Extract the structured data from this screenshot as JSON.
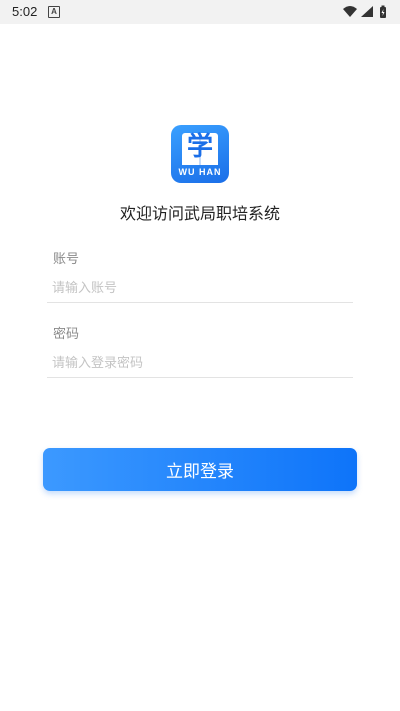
{
  "status_bar": {
    "time": "5:02",
    "notification_glyph": "A",
    "icons": [
      "wifi-icon",
      "signal-icon",
      "battery-icon"
    ]
  },
  "app": {
    "logo_char": "学",
    "logo_text": "WU HAN",
    "welcome": "欢迎访问武局职培系统"
  },
  "form": {
    "account_label": "账号",
    "account_placeholder": "请输入账号",
    "password_label": "密码",
    "password_placeholder": "请输入登录密码"
  },
  "login_button_label": "立即登录",
  "colors": {
    "accent": "#1a7df8",
    "button_gradient_start": "#3c99ff",
    "button_gradient_end": "#0e74f9"
  }
}
